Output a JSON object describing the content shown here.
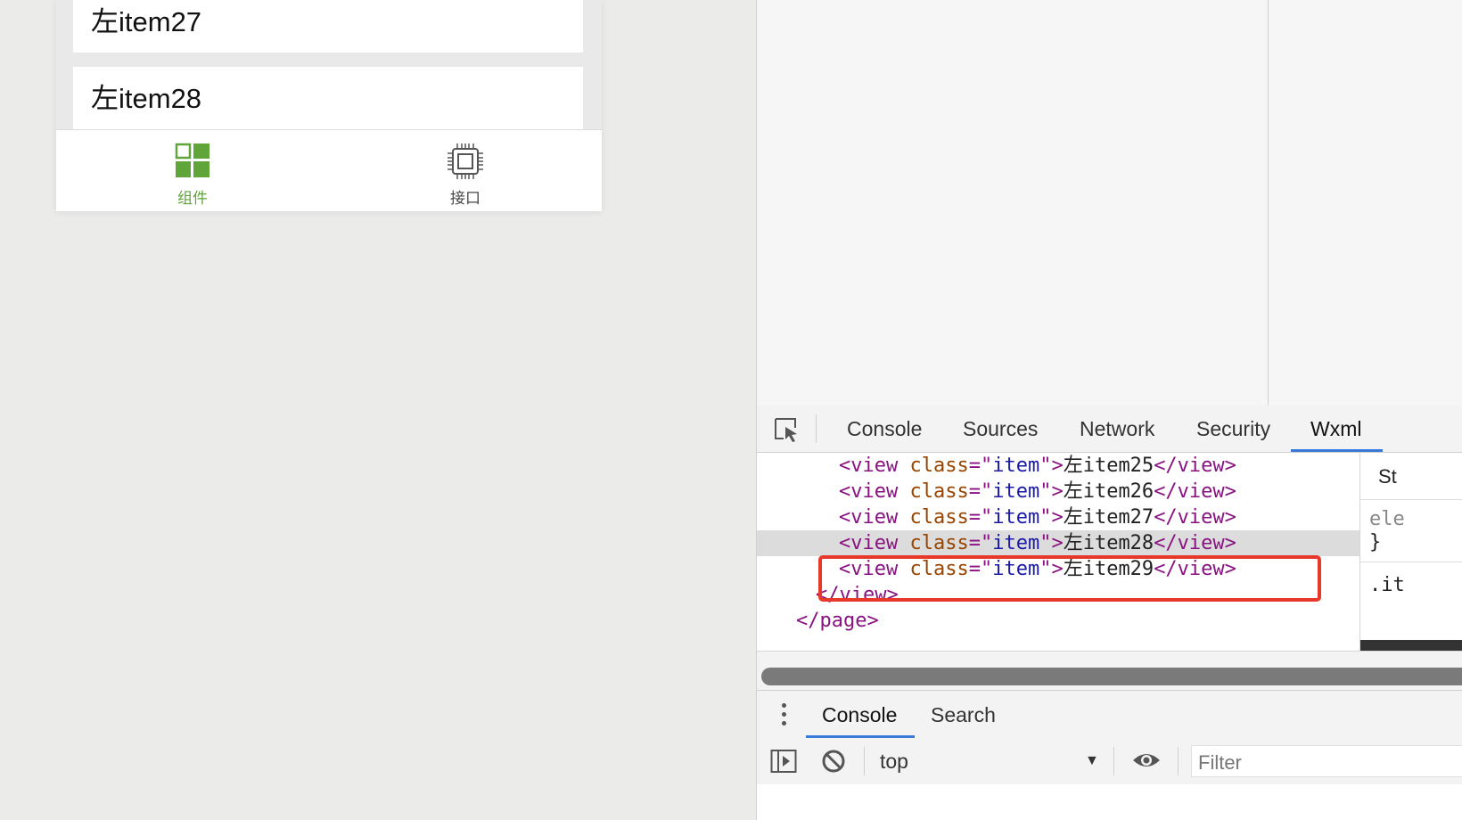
{
  "simulator": {
    "items": [
      "左item27",
      "左item28"
    ],
    "tabbar": {
      "tabs": [
        {
          "label": "组件",
          "icon": "component-grid-icon",
          "active": true,
          "color": "#5fa53a"
        },
        {
          "label": "接口",
          "icon": "chip-api-icon",
          "active": false,
          "color": "#444444"
        }
      ]
    }
  },
  "devtools": {
    "tabs": [
      "Console",
      "Sources",
      "Network",
      "Security",
      "Wxml"
    ],
    "active_tab": "Wxml",
    "wxml_lines": [
      {
        "tag_open": "<view",
        "attr": "class",
        "eq": "=\"",
        "value": "item",
        "close_q": "\">",
        "text": "左item25",
        "tag_close": "</view>"
      },
      {
        "tag_open": "<view",
        "attr": "class",
        "eq": "=\"",
        "value": "item",
        "close_q": "\">",
        "text": "左item26",
        "tag_close": "</view>"
      },
      {
        "tag_open": "<view",
        "attr": "class",
        "eq": "=\"",
        "value": "item",
        "close_q": "\">",
        "text": "左item27",
        "tag_close": "</view>"
      },
      {
        "tag_open": "<view",
        "attr": "class",
        "eq": "=\"",
        "value": "item",
        "close_q": "\">",
        "text": "左item28",
        "tag_close": "</view>"
      },
      {
        "tag_open": "<view",
        "attr": "class",
        "eq": "=\"",
        "value": "item",
        "close_q": "\">",
        "text": "左item29",
        "tag_close": "</view>"
      }
    ],
    "closing_view": "</view>",
    "closing_page": "</page>",
    "styles": {
      "title": "St",
      "line1": "ele",
      "line2": "}",
      "line3": ".it"
    },
    "drawer": {
      "tabs": [
        "Console",
        "Search"
      ],
      "active": "Console"
    },
    "console": {
      "context": "top",
      "filter_placeholder": "Filter"
    },
    "highlight_color": "#e8382a"
  }
}
